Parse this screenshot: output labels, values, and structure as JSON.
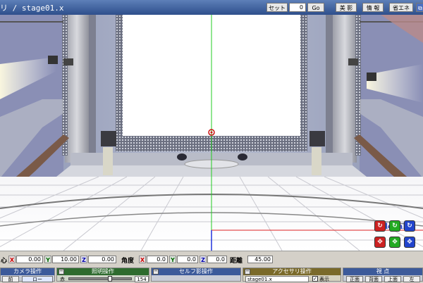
{
  "window": {
    "title": "リ / stage01.x",
    "set_label": "セット",
    "set_value": "0",
    "go_label": "Go",
    "beauty_label": "美 影",
    "info_label": "情 報",
    "eco_label": "省エネ",
    "corner_icon": "window-restore-icon"
  },
  "viewport": {
    "mode_label": "local",
    "axis_colors": {
      "x": "#dd2222",
      "y": "#22cc22",
      "z": "#2233dd"
    },
    "gizmo_icons": [
      "rotate-x-icon",
      "rotate-y-icon",
      "rotate-z-icon",
      "move-x-icon",
      "move-y-icon",
      "move-z-icon"
    ]
  },
  "coords": {
    "center_label": "心",
    "center_x": "0.00",
    "center_y": "10.00",
    "center_z": "0.00",
    "angle_label": "角度",
    "angle_x": "0.0",
    "angle_y": "0.0",
    "angle_z": "0.0",
    "distance_label": "距離",
    "distance_value": "45.00",
    "x_label": "X",
    "y_label": "Y",
    "z_label": "Z"
  },
  "panels": {
    "camera": {
      "title": "カメラ操作",
      "btn1": "前",
      "btn2": "ロー"
    },
    "light": {
      "title": "照明操作",
      "row_label": "赤",
      "value": "154"
    },
    "self_shadow": {
      "title": "セルフ影操作"
    },
    "accessory": {
      "title": "アクセサリ操作",
      "select_value": "stage01.x",
      "show_label": "表示"
    },
    "viewpoint": {
      "title": "視 点",
      "front": "正面",
      "back": "背面",
      "top": "上面",
      "extra": "左"
    }
  }
}
